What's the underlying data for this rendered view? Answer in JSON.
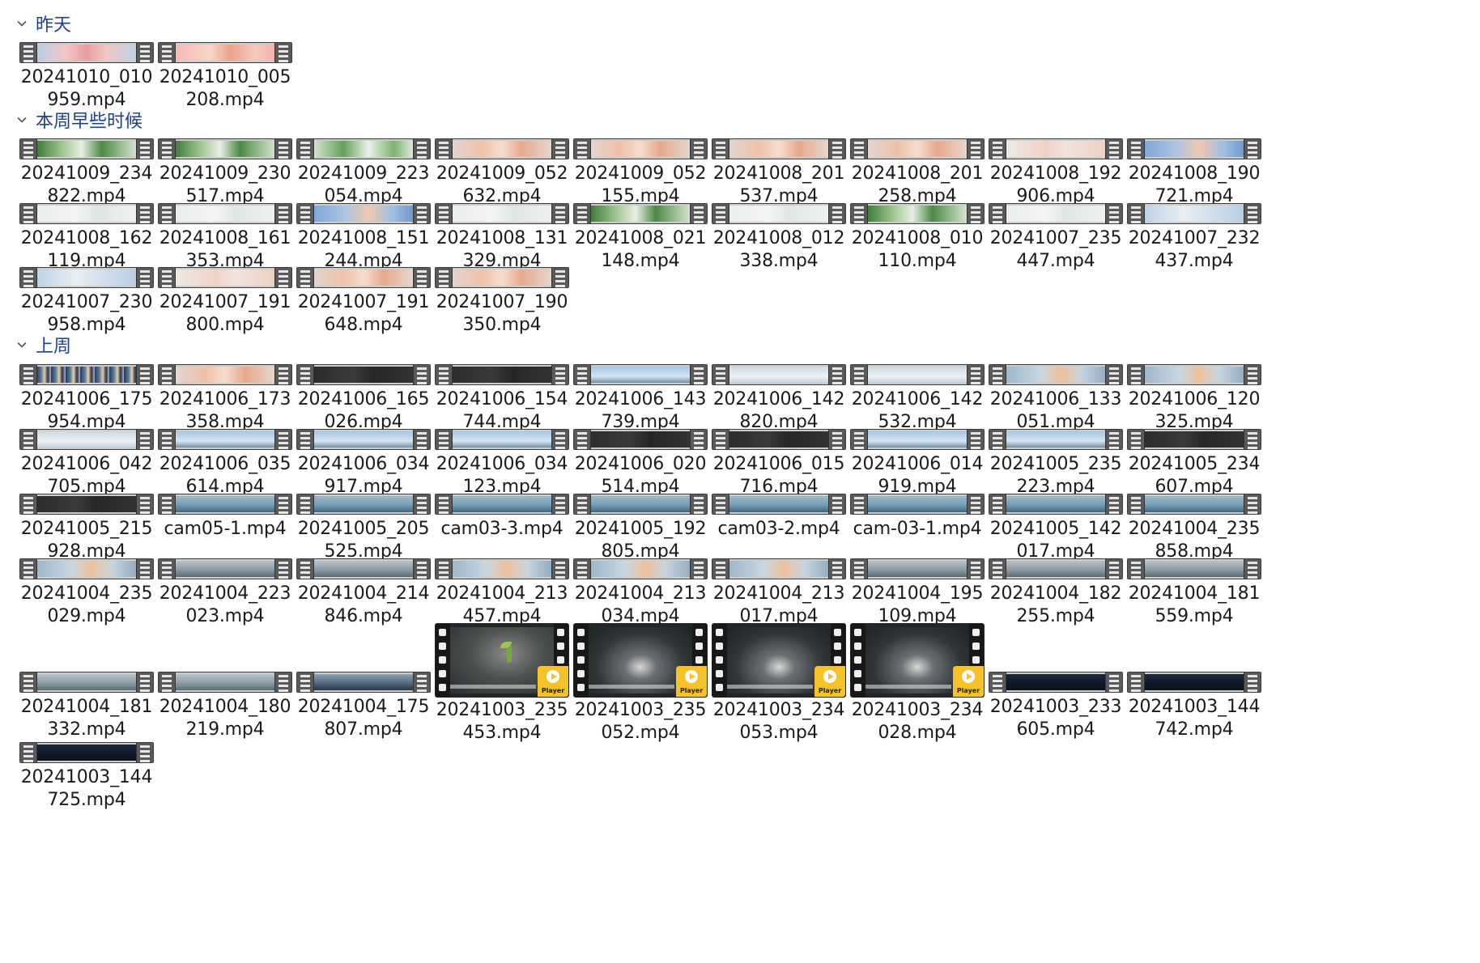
{
  "groups": [
    {
      "title": "昨天",
      "files": [
        {
          "name": "20241010_010\n959.mp4",
          "thumb": "flower"
        },
        {
          "name": "20241010_005\n208.mp4",
          "thumb": "pinkflower"
        }
      ]
    },
    {
      "title": "本周早些时候",
      "files": [
        {
          "name": "20241009_234\n822.mp4",
          "thumb": "green"
        },
        {
          "name": "20241009_230\n517.mp4",
          "thumb": "green"
        },
        {
          "name": "20241009_223\n054.mp4",
          "thumb": "greenlight"
        },
        {
          "name": "20241009_052\n632.mp4",
          "thumb": "peach"
        },
        {
          "name": "20241009_052\n155.mp4",
          "thumb": "peach"
        },
        {
          "name": "20241008_201\n537.mp4",
          "thumb": "peach"
        },
        {
          "name": "20241008_201\n258.mp4",
          "thumb": "peach"
        },
        {
          "name": "20241008_192\n906.mp4",
          "thumb": "peachlight"
        },
        {
          "name": "20241008_190\n721.mp4",
          "thumb": "bluepeach"
        },
        {
          "name": "20241008_162\n119.mp4",
          "thumb": "pale"
        },
        {
          "name": "20241008_161\n353.mp4",
          "thumb": "pale"
        },
        {
          "name": "20241008_151\n244.mp4",
          "thumb": "bluepeach"
        },
        {
          "name": "20241008_131\n329.mp4",
          "thumb": "pale"
        },
        {
          "name": "20241008_021\n148.mp4",
          "thumb": "green"
        },
        {
          "name": "20241008_012\n338.mp4",
          "thumb": "pale"
        },
        {
          "name": "20241008_010\n110.mp4",
          "thumb": "green"
        },
        {
          "name": "20241007_235\n447.mp4",
          "thumb": "pale"
        },
        {
          "name": "20241007_232\n437.mp4",
          "thumb": "bluepale"
        },
        {
          "name": "20241007_230\n958.mp4",
          "thumb": "bluepale"
        },
        {
          "name": "20241007_191\n800.mp4",
          "thumb": "peachlight"
        },
        {
          "name": "20241007_191\n648.mp4",
          "thumb": "peach"
        },
        {
          "name": "20241007_190\n350.mp4",
          "thumb": "peach"
        }
      ]
    },
    {
      "title": "上周",
      "files": [
        {
          "name": "20241006_175\n954.mp4",
          "thumb": "collage"
        },
        {
          "name": "20241006_173\n358.mp4",
          "thumb": "peach"
        },
        {
          "name": "20241006_165\n026.mp4",
          "thumb": "dark"
        },
        {
          "name": "20241006_154\n744.mp4",
          "thumb": "dark"
        },
        {
          "name": "20241006_143\n739.mp4",
          "thumb": "sky"
        },
        {
          "name": "20241006_142\n820.mp4",
          "thumb": "skypale"
        },
        {
          "name": "20241006_142\n532.mp4",
          "thumb": "skypale"
        },
        {
          "name": "20241006_133\n051.mp4",
          "thumb": "skypeach"
        },
        {
          "name": "20241006_120\n325.mp4",
          "thumb": "skypeach"
        },
        {
          "name": "20241006_042\n705.mp4",
          "thumb": "skypale"
        },
        {
          "name": "20241006_035\n614.mp4",
          "thumb": "sky"
        },
        {
          "name": "20241006_034\n917.mp4",
          "thumb": "sky"
        },
        {
          "name": "20241006_034\n123.mp4",
          "thumb": "sky"
        },
        {
          "name": "20241006_020\n514.mp4",
          "thumb": "dark"
        },
        {
          "name": "20241006_015\n716.mp4",
          "thumb": "dark"
        },
        {
          "name": "20241006_014\n919.mp4",
          "thumb": "sky"
        },
        {
          "name": "20241005_235\n223.mp4",
          "thumb": "sky"
        },
        {
          "name": "20241005_234\n607.mp4",
          "thumb": "dark"
        },
        {
          "name": "20241005_215\n928.mp4",
          "thumb": "dark"
        },
        {
          "name": "cam05-1.mp4",
          "thumb": "teal"
        },
        {
          "name": "20241005_205\n525.mp4",
          "thumb": "teal"
        },
        {
          "name": "cam03-3.mp4",
          "thumb": "teal"
        },
        {
          "name": "20241005_192\n805.mp4",
          "thumb": "teal"
        },
        {
          "name": "cam03-2.mp4",
          "thumb": "teal"
        },
        {
          "name": "cam-03-1.mp4",
          "thumb": "teal"
        },
        {
          "name": "20241005_142\n017.mp4",
          "thumb": "teal"
        },
        {
          "name": "20241004_235\n858.mp4",
          "thumb": "teal"
        },
        {
          "name": "20241004_235\n029.mp4",
          "thumb": "skypeach"
        },
        {
          "name": "20241004_223\n023.mp4",
          "thumb": "grey"
        },
        {
          "name": "20241004_214\n846.mp4",
          "thumb": "grey"
        },
        {
          "name": "20241004_213\n457.mp4",
          "thumb": "skypeach"
        },
        {
          "name": "20241004_213\n034.mp4",
          "thumb": "skypeach"
        },
        {
          "name": "20241004_213\n017.mp4",
          "thumb": "skypeach"
        },
        {
          "name": "20241004_195\n109.mp4",
          "thumb": "grey"
        },
        {
          "name": "20241004_182\n255.mp4",
          "thumb": "grey"
        },
        {
          "name": "20241004_181\n559.mp4",
          "thumb": "grey"
        },
        {
          "name": "20241004_181\n332.mp4",
          "thumb": "grey"
        },
        {
          "name": "20241004_180\n219.mp4",
          "thumb": "grey"
        },
        {
          "name": "20241004_175\n807.mp4",
          "thumb": "slate"
        },
        {
          "name": "20241003_235\n453.mp4",
          "thumb": "player-plant",
          "badge": "Player"
        },
        {
          "name": "20241003_235\n052.mp4",
          "thumb": "player",
          "badge": "Player"
        },
        {
          "name": "20241003_234\n053.mp4",
          "thumb": "player",
          "badge": "Player"
        },
        {
          "name": "20241003_234\n028.mp4",
          "thumb": "player",
          "badge": "Player"
        },
        {
          "name": "20241003_233\n605.mp4",
          "thumb": "navy"
        },
        {
          "name": "20241003_144\n742.mp4",
          "thumb": "navy"
        },
        {
          "name": "20241003_144\n725.mp4",
          "thumb": "navy"
        }
      ]
    }
  ],
  "colors": {
    "header_text": "#1e3f8a",
    "badge_yellow": "#f6c22a"
  },
  "icons": {
    "group_toggle": "chevron-down-icon",
    "video_thumb": "film-strip-icon",
    "player_badge": "player-play-icon"
  }
}
